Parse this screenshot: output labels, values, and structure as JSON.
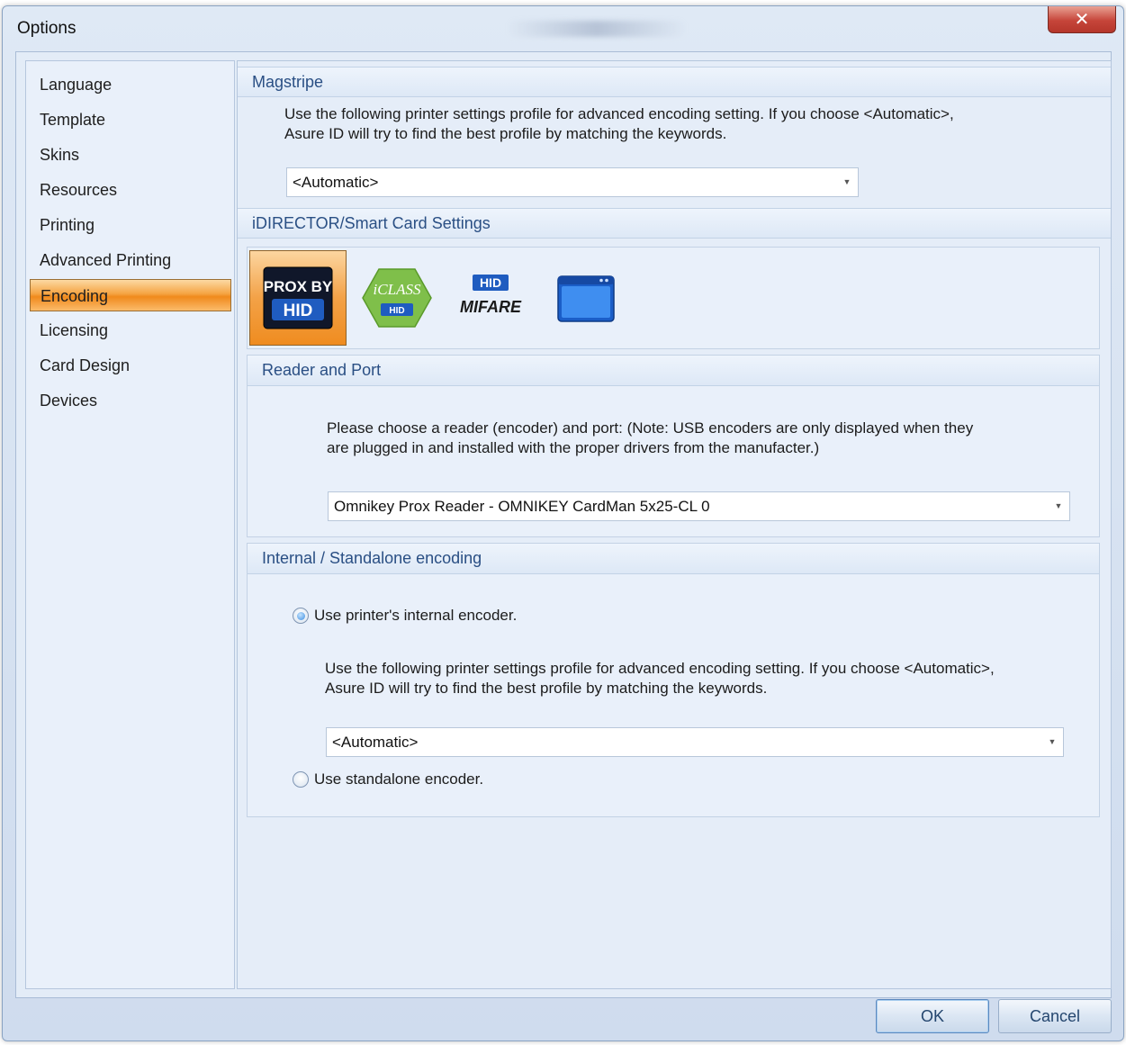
{
  "window": {
    "title": "Options"
  },
  "sidebar": {
    "items": [
      {
        "label": "Language"
      },
      {
        "label": "Template"
      },
      {
        "label": "Skins"
      },
      {
        "label": "Resources"
      },
      {
        "label": "Printing"
      },
      {
        "label": "Advanced Printing"
      },
      {
        "label": "Encoding",
        "active": true
      },
      {
        "label": "Licensing"
      },
      {
        "label": "Card Design"
      },
      {
        "label": "Devices"
      }
    ]
  },
  "magstripe": {
    "header": "Magstripe",
    "description_line1": "Use the following printer settings profile for advanced encoding setting. If you choose <Automatic>,",
    "description_line2": "Asure ID will try to find the best profile by matching the keywords.",
    "profile_value": "<Automatic>"
  },
  "smartcard": {
    "header": "iDIRECTOR/Smart Card Settings",
    "card_types": [
      {
        "name": "prox-by-hid",
        "label_top": "PROX BY",
        "label_bottom": "HID",
        "selected": true
      },
      {
        "name": "iclass-by-hid",
        "label_top": "iCLASS",
        "label_bottom": "HID",
        "selected": false
      },
      {
        "name": "hid-mifare",
        "label_top": "HID",
        "label_bottom": "MIFARE",
        "selected": false
      },
      {
        "name": "generic-window",
        "selected": false
      }
    ]
  },
  "reader": {
    "header": "Reader and Port",
    "description_line1": "Please choose a reader (encoder) and port: (Note: USB encoders are only displayed when they",
    "description_line2": "are plugged in and installed with the proper drivers from the manufacter.)",
    "selected_reader": "Omnikey Prox Reader - OMNIKEY CardMan 5x25-CL 0"
  },
  "internal": {
    "header": "Internal / Standalone encoding",
    "option_internal": "Use printer's internal encoder.",
    "option_standalone": "Use standalone encoder.",
    "selected_option": "internal",
    "description_line1": "Use the following printer settings profile for advanced encoding setting. If you choose <Automatic>,",
    "description_line2": "Asure ID will try to find the best profile by matching the keywords.",
    "profile_value": "<Automatic>"
  },
  "footer": {
    "ok_label": "OK",
    "cancel_label": "Cancel"
  },
  "colors": {
    "accent_orange": "#f08a1c",
    "header_text": "#2a4f84",
    "close_red": "#c6453a"
  }
}
